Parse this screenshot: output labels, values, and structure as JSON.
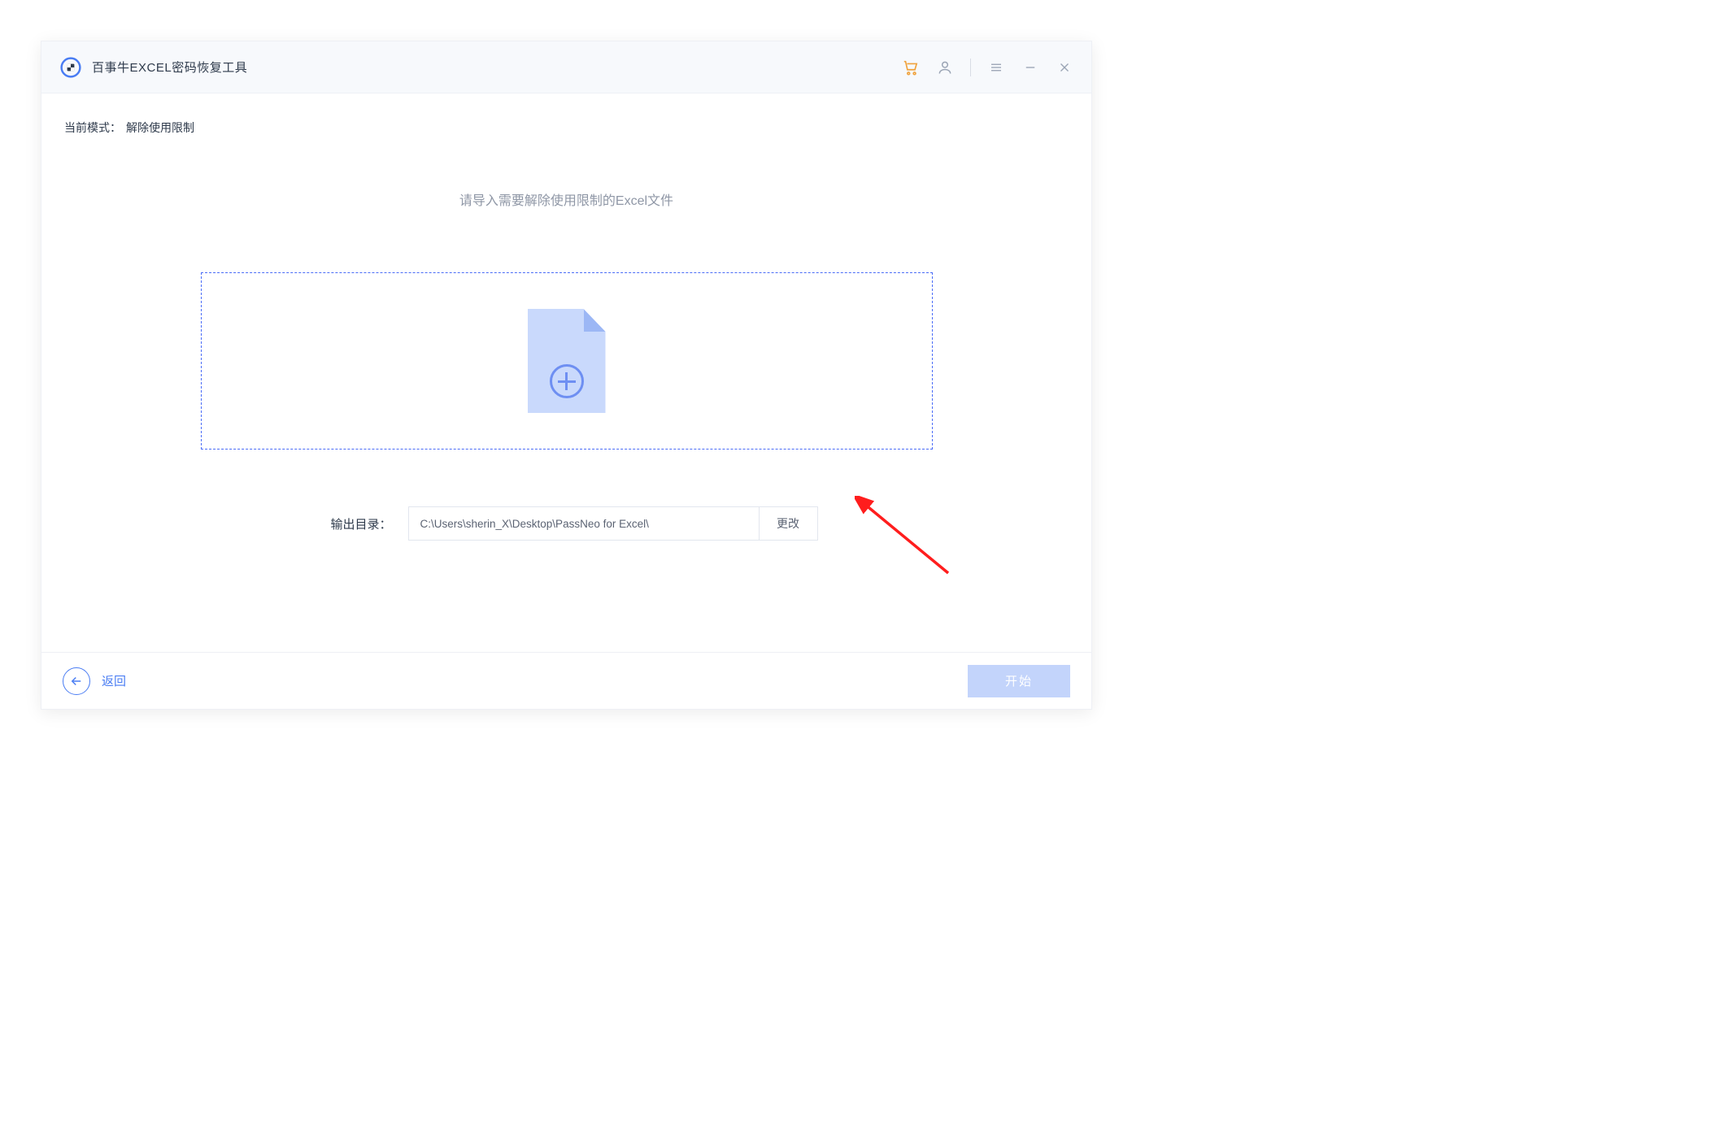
{
  "header": {
    "app_title": "百事牛EXCEL密码恢复工具"
  },
  "mode": {
    "label": "当前模式：",
    "value": "解除使用限制"
  },
  "main": {
    "prompt": "请导入需要解除使用限制的Excel文件",
    "output_label": "输出目录：",
    "output_path": "C:\\Users\\sherin_X\\Desktop\\PassNeo for Excel\\",
    "change_btn": "更改"
  },
  "footer": {
    "back_label": "返回",
    "start_label": "开始"
  }
}
